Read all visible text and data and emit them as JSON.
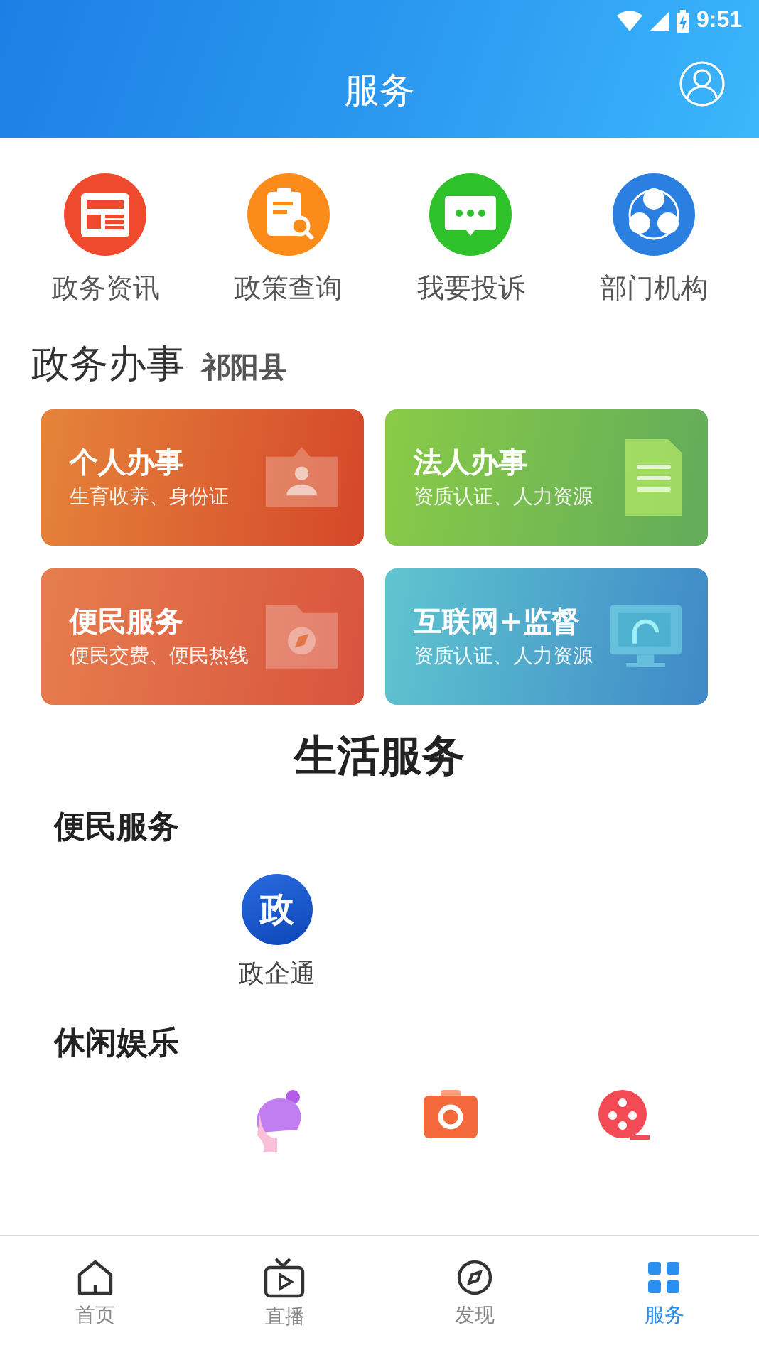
{
  "status_bar": {
    "time": "9:51"
  },
  "header": {
    "title": "服务"
  },
  "quick_links": [
    {
      "label": "政务资讯",
      "kind": "news"
    },
    {
      "label": "政策查询",
      "kind": "policy"
    },
    {
      "label": "我要投诉",
      "kind": "complaint"
    },
    {
      "label": "部门机构",
      "kind": "org"
    }
  ],
  "affairs": {
    "title": "政务办事",
    "region": "祁阳县",
    "cards": [
      {
        "title": "个人办事",
        "subtitle": "生育收养、身份证",
        "kind": "personal"
      },
      {
        "title": "法人办事",
        "subtitle": "资质认证、人力资源",
        "kind": "legal"
      },
      {
        "title": "便民服务",
        "subtitle": "便民交费、便民热线",
        "kind": "convenience"
      },
      {
        "title": "互联网+监督",
        "subtitle": "资质认证、人力资源",
        "kind": "supervision"
      }
    ]
  },
  "life": {
    "title": "生活服务",
    "groups": [
      {
        "title": "便民服务",
        "items": [
          {
            "kind": "gov",
            "glyph": "政",
            "label": "政企通"
          }
        ]
      },
      {
        "title": "休闲娱乐",
        "items": [
          {
            "kind": "beauty"
          },
          {
            "kind": "camera"
          },
          {
            "kind": "film"
          }
        ]
      }
    ]
  },
  "bottom_nav": [
    {
      "label": "首页",
      "kind": "home",
      "selected": false
    },
    {
      "label": "直播",
      "kind": "live",
      "selected": false
    },
    {
      "label": "发现",
      "kind": "discover",
      "selected": false
    },
    {
      "label": "服务",
      "kind": "service",
      "selected": true
    }
  ]
}
